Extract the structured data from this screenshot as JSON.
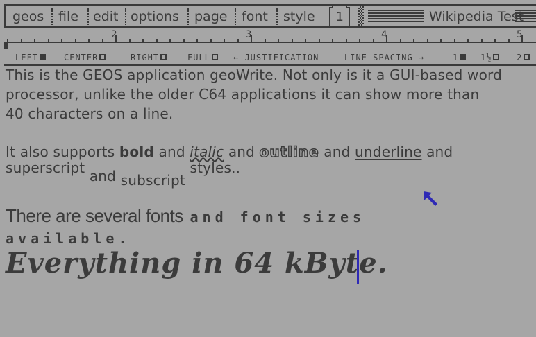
{
  "menubar": {
    "items": [
      "geos",
      "file",
      "edit",
      "options",
      "page",
      "font",
      "style"
    ],
    "page_number": "1",
    "document_title": "Wikipedia Test"
  },
  "ruler": {
    "numbers": [
      "2",
      "3",
      "4",
      "5"
    ]
  },
  "justification_bar": {
    "left_label": "LEFT",
    "center_label": "CENTER",
    "right_label": "RIGHT",
    "full_label": "FULL",
    "justification_label": "← JUSTIFICATION",
    "line_spacing_label": "LINE SPACING →",
    "spacing_options": [
      "1",
      "1½",
      "2"
    ],
    "selected_justification": "LEFT",
    "selected_spacing": "1"
  },
  "document": {
    "para1_lines": [
      "This is the GEOS application geoWrite. Not only is it a GUI-based word",
      "processor, unlike the older C64 applications it can show more than",
      "40 characters on a line."
    ],
    "para2": {
      "it_also_supports": "It also supports",
      "bold": "bold",
      "and1": "and",
      "italic": "italic",
      "and2": "and",
      "outline": "outline",
      "and3": "and",
      "underline": "underline",
      "and4": "and",
      "superscript": "superscript",
      "and5": "and",
      "subscript": "subscript",
      "styles": "styles.."
    },
    "fonts_line1_a": "There are several fonts",
    "fonts_line1_b": "and font sizes",
    "fonts_line2": "available.",
    "gothic_line": "Everything in 64 kByte."
  },
  "colors": {
    "background": "#a6a6a6",
    "foreground": "#3b3b3b",
    "text_cursor": "#2f2ab5",
    "mouse_pointer": "#2f2ab5"
  },
  "icons": {
    "mouse_pointer": "arrow-pointer-icon",
    "text_cursor": "text-cursor-icon"
  }
}
